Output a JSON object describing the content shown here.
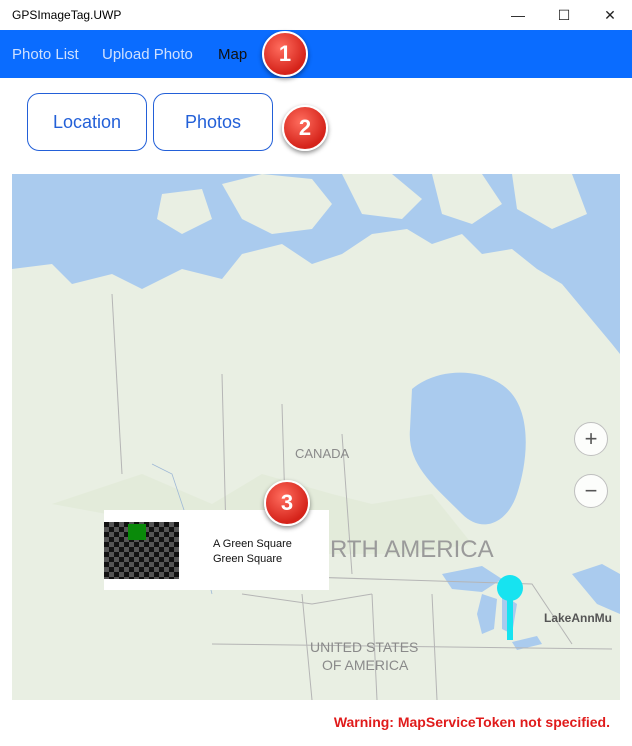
{
  "window": {
    "title": "GPSImageTag.UWP",
    "minimize_glyph": "—",
    "maximize_glyph": "☐",
    "close_glyph": "✕"
  },
  "nav": {
    "items": [
      {
        "label": "Photo List"
      },
      {
        "label": "Upload Photo"
      },
      {
        "label": "Map",
        "active": true
      }
    ]
  },
  "buttons": {
    "location": "Location",
    "photos": "Photos"
  },
  "badges": [
    "1",
    "2",
    "3"
  ],
  "map": {
    "labels": {
      "canada": "CANADA",
      "north_america": "RTH AMERICA",
      "usa_line1": "UNITED STATES",
      "usa_line2": "OF AMERICA",
      "pin_label": "LakeAnnMu"
    },
    "zoom_in": "+",
    "zoom_out": "−",
    "popup": {
      "line1": "A Green Square",
      "line2": "Green Square"
    },
    "pin_color": "#17e3f0"
  },
  "warning": "Warning: MapServiceToken not specified.",
  "colors": {
    "nav_bg": "#0a6cff",
    "accent": "#2360d8",
    "warning": "#e01b1b",
    "water": "#aacbee",
    "land": "#e8efe2"
  }
}
